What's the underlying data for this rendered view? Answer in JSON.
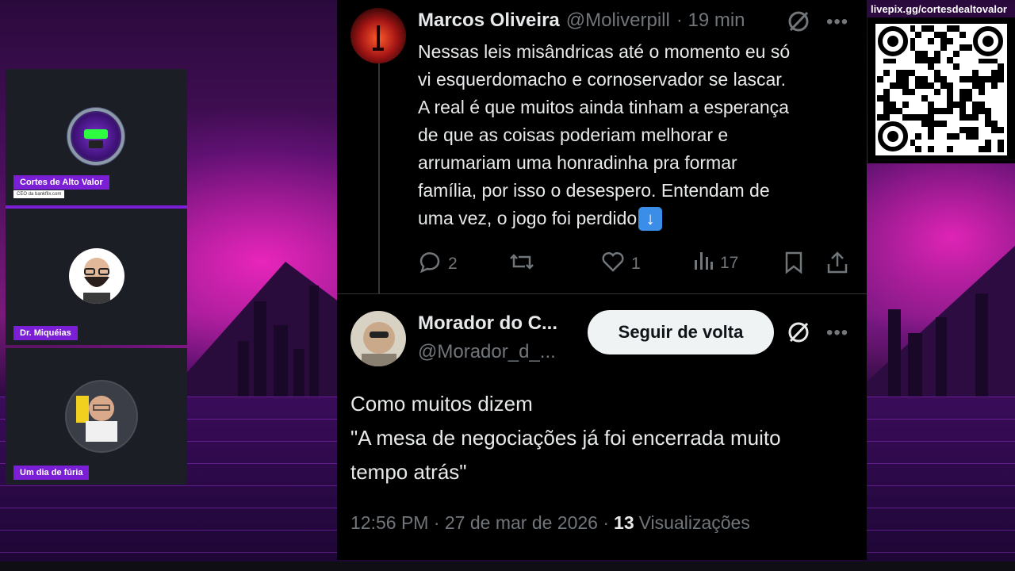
{
  "cams": [
    {
      "name": "Cortes de Alto Valor",
      "subtitle": "CEO da bankflix.com"
    },
    {
      "name": "Dr. Miquéias"
    },
    {
      "name": "Um dia de fúria"
    }
  ],
  "qr": {
    "label": "livepix.gg/cortesdealtovalor"
  },
  "tweet1": {
    "name": "Marcos Oliveira",
    "handle": "@Moliverpill",
    "time": "· 19 min",
    "lines": [
      "Nessas leis misândricas até o momento eu só",
      "vi esquerdomacho e cornoservador se lascar.",
      "A real é que muitos ainda tinham a esperança",
      "de que as coisas poderiam melhorar e",
      "arrumariam uma honradinha pra formar",
      "família, por isso o desespero. Entendam de",
      "uma vez, o jogo foi perdido"
    ],
    "replies": "2",
    "likes": "1",
    "views": "17"
  },
  "tweet2": {
    "name": "Morador do C...",
    "handle": "@Morador_d_...",
    "follow_label": "Seguir de volta",
    "lines": [
      "Como muitos dizem",
      "\"A mesa de negociações já foi encerrada muito",
      "tempo atrás\""
    ],
    "meta": "12:56 PM · 27 de mar de 2026 ·",
    "views_count": "13",
    "views_label": "Visualizações"
  },
  "colors": {
    "accent": "#7a1fd6",
    "follow_bg": "#eff3f4",
    "panel": "#000000"
  }
}
